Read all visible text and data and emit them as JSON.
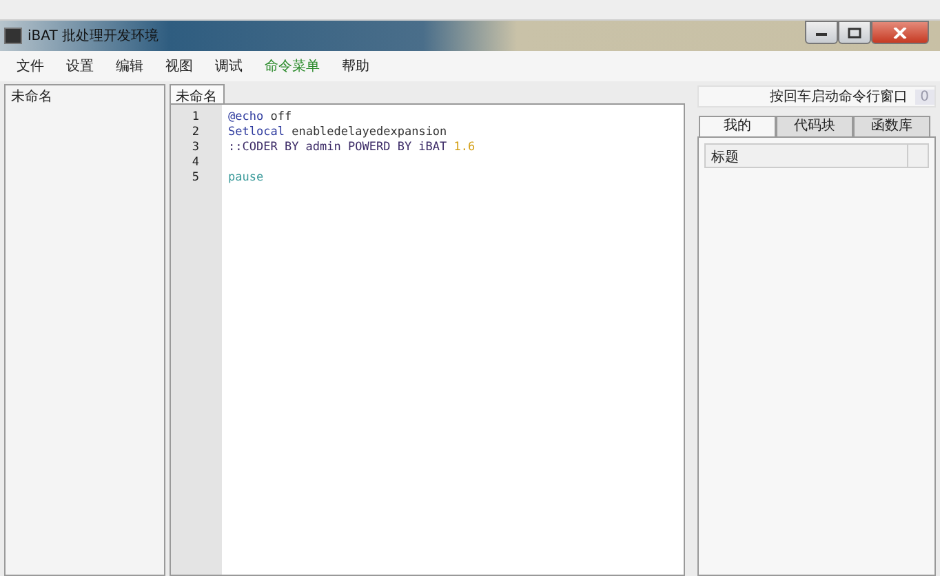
{
  "window": {
    "title": "iBAT 批处理开发环境"
  },
  "menu": [
    "文件",
    "设置",
    "编辑",
    "视图",
    "调试",
    {
      "label": "命令菜单",
      "highlight": true
    },
    "帮助"
  ],
  "explorer": {
    "title": "未命名"
  },
  "editor": {
    "tabs": [
      {
        "label": "未命名",
        "selected": true
      }
    ],
    "lines": [
      {
        "number": "1",
        "tokens": [
          {
            "kind": "keyword",
            "text": "@echo"
          },
          {
            "kind": "plain",
            "text": " off"
          }
        ]
      },
      {
        "number": "2",
        "tokens": [
          {
            "kind": "keyword",
            "text": "Setlocal"
          },
          {
            "kind": "plain",
            "text": " enabledelayedexpansion"
          }
        ]
      },
      {
        "number": "3",
        "tokens": [
          {
            "kind": "comment",
            "text": "::CODER BY admin POWERD BY iBAT "
          },
          {
            "kind": "number",
            "text": "1.6"
          }
        ]
      },
      {
        "number": "4"
      },
      {
        "number": "5",
        "tokens": [
          {
            "kind": "command",
            "text": "pause"
          }
        ]
      }
    ]
  },
  "side": {
    "hint": "按回车启动命令行窗口",
    "count": "0",
    "tabs": [
      {
        "label": "我的",
        "selected": true
      },
      {
        "label": "代码块",
        "selected": false
      },
      {
        "label": "函数库",
        "selected": false
      }
    ],
    "columns": [
      "标题"
    ]
  }
}
